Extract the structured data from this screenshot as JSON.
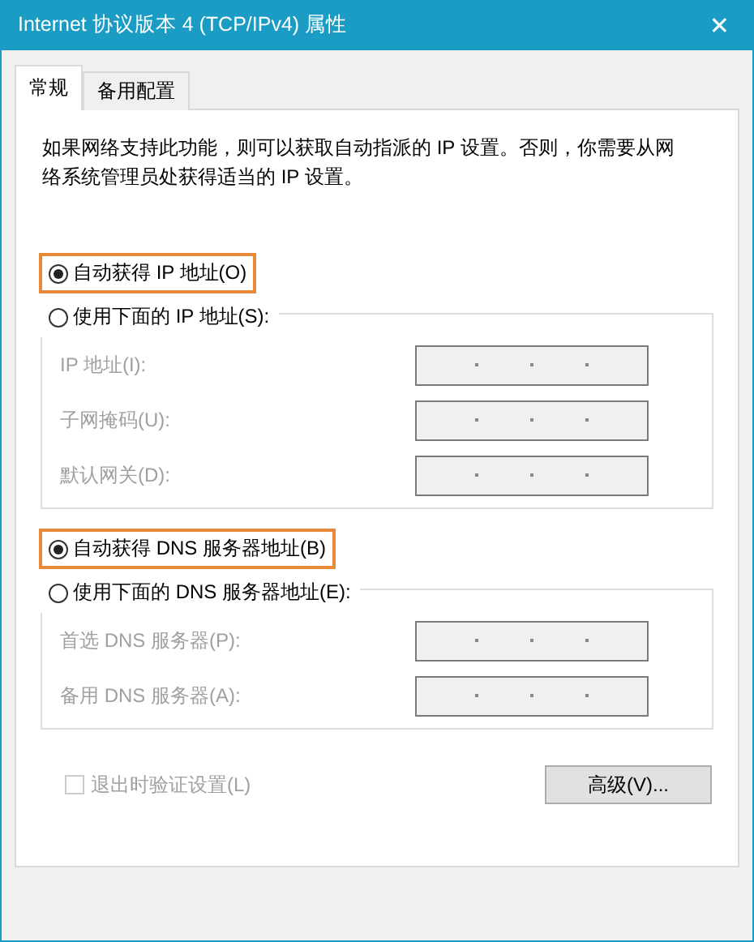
{
  "window": {
    "title": "Internet 协议版本 4 (TCP/IPv4) 属性",
    "close": "✕"
  },
  "tabs": [
    {
      "label": "常规",
      "selected": true
    },
    {
      "label": "备用配置",
      "selected": false
    }
  ],
  "description": "如果网络支持此功能，则可以获取自动指派的 IP 设置。否则，你需要从网络系统管理员处获得适当的 IP 设置。",
  "sections": [
    {
      "auto_option": {
        "label": "自动获得 IP 地址(O)",
        "selected": true,
        "highlighted": true
      },
      "manual_option": {
        "label": "使用下面的 IP 地址(S):",
        "selected": false
      },
      "fields": [
        {
          "label": "IP 地址(I):",
          "disabled": true
        },
        {
          "label": "子网掩码(U):",
          "disabled": true
        },
        {
          "label": "默认网关(D):",
          "disabled": true
        }
      ]
    },
    {
      "auto_option": {
        "label": "自动获得 DNS 服务器地址(B)",
        "selected": true,
        "highlighted": true
      },
      "manual_option": {
        "label": "使用下面的 DNS 服务器地址(E):",
        "selected": false
      },
      "fields": [
        {
          "label": "首选 DNS 服务器(P):",
          "disabled": true
        },
        {
          "label": "备用 DNS 服务器(A):",
          "disabled": true
        }
      ]
    }
  ],
  "validate_on_exit": {
    "label": "退出时验证设置(L)",
    "checked": false,
    "disabled": true
  },
  "advanced_button": {
    "label": "高级(V)..."
  }
}
